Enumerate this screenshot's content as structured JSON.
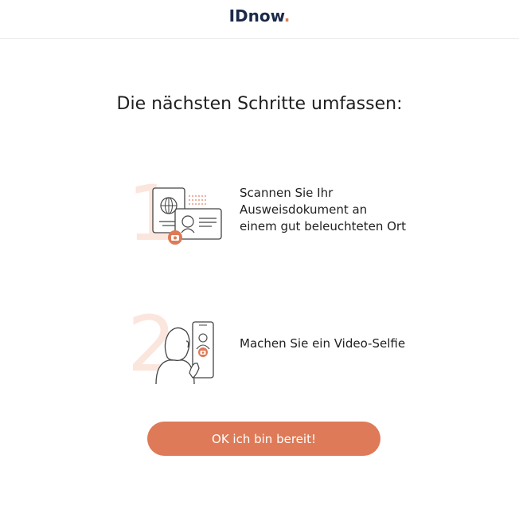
{
  "header": {
    "logo_text": "IDnow",
    "logo_dot": "."
  },
  "main": {
    "title": "Die nächsten Schritte umfassen:",
    "steps": [
      {
        "number": "1",
        "icon": "id-document-scan-icon",
        "text": "Scannen Sie Ihr Ausweisdokument an einem gut beleuchteten Ort"
      },
      {
        "number": "2",
        "icon": "video-selfie-icon",
        "text": "Machen Sie ein Video-Selfie"
      }
    ],
    "ok_button": "OK ich bin bereit!"
  },
  "colors": {
    "accent": "#de7a57",
    "logo": "#1b2a4a",
    "step_number": "#fbe6dd"
  }
}
